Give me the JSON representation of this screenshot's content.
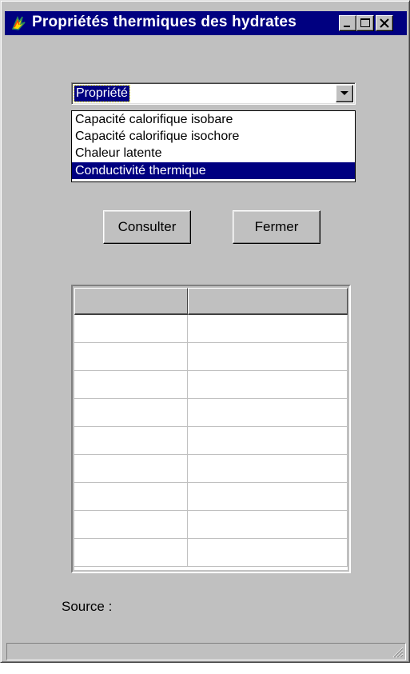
{
  "window": {
    "title": "Propriétés thermiques des hydrates",
    "minimize_icon": "minimize-icon",
    "maximize_icon": "maximize-icon",
    "close_icon": "close-icon"
  },
  "combo": {
    "selected": "Propriété",
    "arrow_icon": "chevron-down-icon"
  },
  "dropdown": {
    "items": [
      "Capacité calorifique isobare",
      "Capacité calorifique isochore",
      "Chaleur latente",
      "Conductivité thermique"
    ],
    "highlighted_index": 3
  },
  "buttons": {
    "consult_label": "Consulter",
    "close_label": "Fermer"
  },
  "grid": {
    "columns": [
      "",
      ""
    ],
    "rows": [
      [
        "",
        ""
      ],
      [
        "",
        ""
      ],
      [
        "",
        ""
      ],
      [
        "",
        ""
      ],
      [
        "",
        ""
      ],
      [
        "",
        ""
      ],
      [
        "",
        ""
      ],
      [
        "",
        ""
      ],
      [
        "",
        ""
      ]
    ]
  },
  "source": {
    "label": "Source :"
  },
  "colors": {
    "face": "#c0c0c0",
    "title_bar": "#000080",
    "selection": "#000080"
  }
}
